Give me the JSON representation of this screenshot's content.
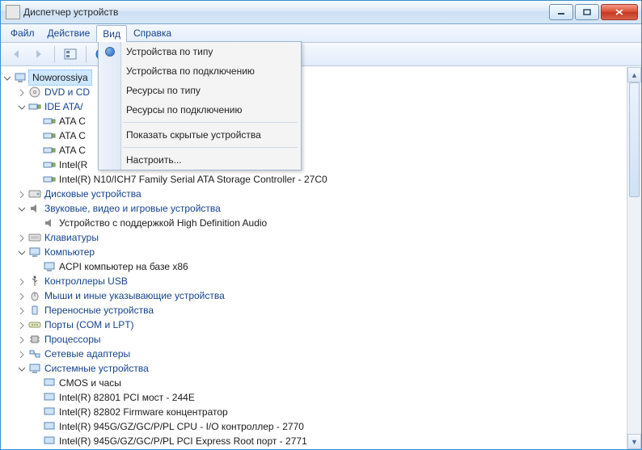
{
  "window": {
    "title": "Диспетчер устройств"
  },
  "menubar": {
    "file": "Файл",
    "action": "Действие",
    "view": "Вид",
    "help": "Справка"
  },
  "view_menu": {
    "by_type": "Устройства по типу",
    "by_connection": "Устройства по подключению",
    "res_by_type": "Ресурсы по типу",
    "res_by_conn": "Ресурсы по подключению",
    "show_hidden": "Показать скрытые устройства",
    "customize": "Настроить..."
  },
  "tree": {
    "root": "Noworossiya",
    "dvd": "DVD и CD",
    "ide": "IDE ATA/",
    "ata0": "ATA C",
    "ata1": "ATA C",
    "ata2": "ATA C",
    "intel_r": "Intel(R",
    "intel_n10": "Intel(R) N10/ICH7 Family Serial ATA Storage Controller - 27C0",
    "disk": "Дисковые устройства",
    "sound": "Звуковые, видео и игровые устройства",
    "hdaudio": "Устройство с поддержкой High Definition Audio",
    "keyboards": "Клавиатуры",
    "computer": "Компьютер",
    "acpi": "ACPI компьютер на базе x86",
    "usb": "Контроллеры USB",
    "mice": "Мыши и иные указывающие устройства",
    "portable": "Переносные устройства",
    "ports": "Порты (COM и LPT)",
    "cpu": "Процессоры",
    "net": "Сетевые адаптеры",
    "system": "Системные устройства",
    "cmos": "CMOS и часы",
    "pci_bridge": "Intel(R) 82801 PCI мост - 244E",
    "fw_hub": "Intel(R) 82802 Firmware концентратор",
    "io_ctrl": "Intel(R) 945G/GZ/GC/P/PL CPU - I/O контроллер - 2770",
    "pci_root": "Intel(R) 945G/GZ/GC/P/PL PCI Express Root порт - 2771"
  }
}
